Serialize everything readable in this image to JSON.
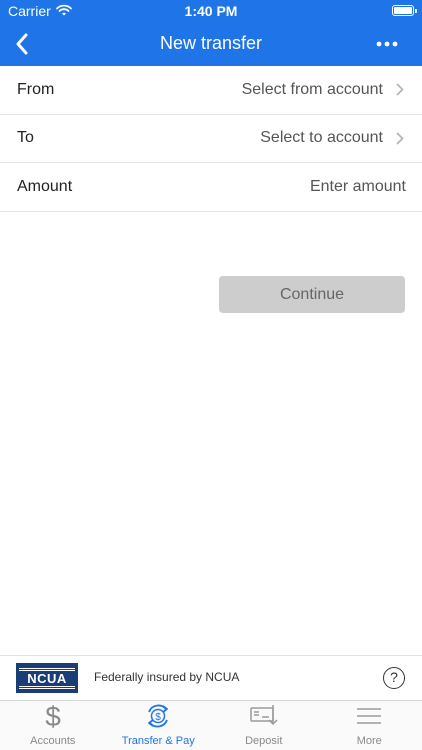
{
  "status_bar": {
    "carrier": "Carrier",
    "time": "1:40 PM"
  },
  "nav": {
    "title": "New transfer"
  },
  "form": {
    "from_label": "From",
    "from_value": "Select from account",
    "to_label": "To",
    "to_value": "Select to account",
    "amount_label": "Amount",
    "amount_placeholder": "Enter amount"
  },
  "continue_label": "Continue",
  "ncua": {
    "logo_text": "NCUA",
    "text": "Federally insured by NCUA",
    "help": "?"
  },
  "tabs": [
    {
      "label": "Accounts",
      "icon": "dollar-icon",
      "active": false
    },
    {
      "label": "Transfer & Pay",
      "icon": "transfer-pay-icon",
      "active": true
    },
    {
      "label": "Deposit",
      "icon": "check-deposit-icon",
      "active": false
    },
    {
      "label": "More",
      "icon": "menu-icon",
      "active": false
    }
  ],
  "colors": {
    "brand": "#1f74e8",
    "disabled_button": "#cdcdcd",
    "ncua_navy": "#1b3d75"
  }
}
